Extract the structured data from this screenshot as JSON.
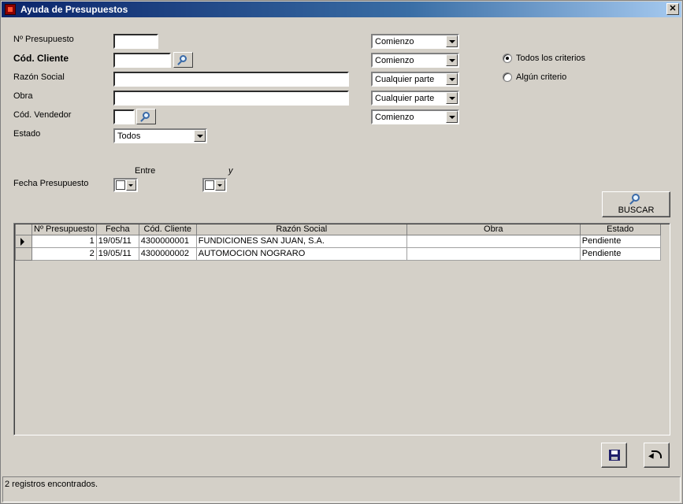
{
  "window": {
    "title": "Ayuda de Presupuestos",
    "close_glyph": "✕"
  },
  "form": {
    "presupuesto_label": "Nº Presupuesto",
    "presupuesto_value": "",
    "cliente_label": "Cód. Cliente",
    "cliente_value": "",
    "razon_label": "Razón Social",
    "razon_value": "",
    "obra_label": "Obra",
    "obra_value": "",
    "vendedor_label": "Cód. Vendedor",
    "vendedor_value": "",
    "estado_label": "Estado",
    "estado_value": "Todos",
    "match_presupuesto": "Comienzo",
    "match_cliente": "Comienzo",
    "match_razon": "Cualquier parte",
    "match_obra": "Cualquier parte",
    "match_vendedor": "Comienzo",
    "criteria_all": "Todos los criterios",
    "criteria_any": "Algún criterio",
    "criteria_selected": "all",
    "fecha_label": "Fecha Presupuesto",
    "entre_label": "Entre",
    "y_label": "y"
  },
  "buttons": {
    "buscar": "BUSCAR"
  },
  "grid": {
    "columns": [
      "Nº Presupuesto",
      "Fecha",
      "Cód. Cliente",
      "Razón Social",
      "Obra",
      "Estado"
    ],
    "rows": [
      {
        "num": "1",
        "fecha": "19/05/11",
        "cliente": "4300000001",
        "razon": "FUNDICIONES SAN JUAN, S.A.",
        "obra": "",
        "estado": "Pendiente"
      },
      {
        "num": "2",
        "fecha": "19/05/11",
        "cliente": "4300000002",
        "razon": "AUTOMOCION NOGRARO",
        "obra": "",
        "estado": "Pendiente"
      }
    ]
  },
  "status": {
    "text": "2 registros encontrados."
  }
}
